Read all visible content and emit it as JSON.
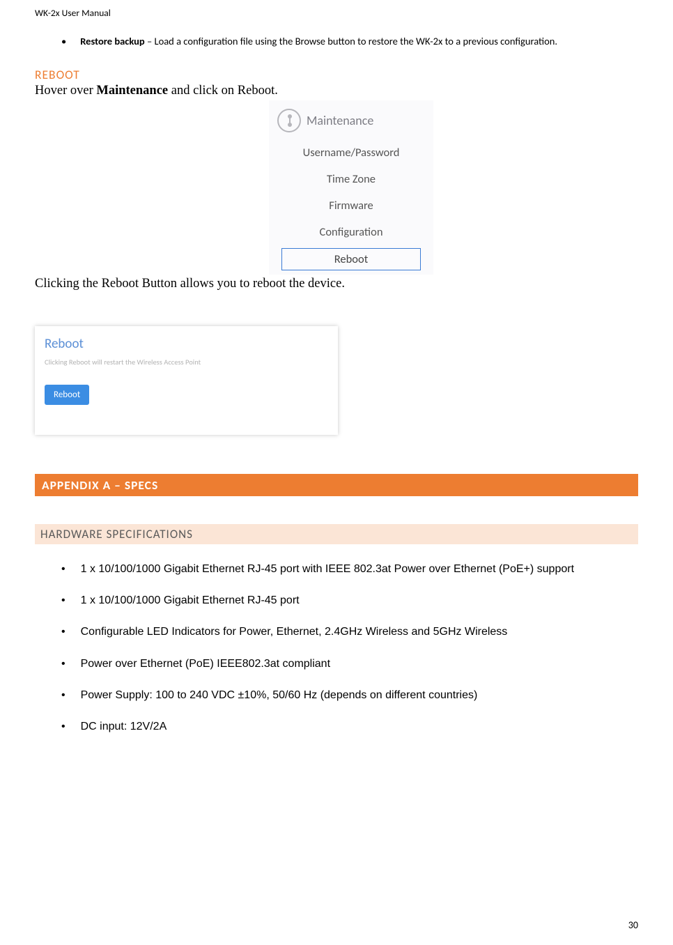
{
  "header": "WK-2x User Manual",
  "intro": {
    "label": "Restore backup",
    "text": " – Load a configuration file using the Browse button to restore the WK-2x to a previous configuration."
  },
  "rebootSection": {
    "title": "REBOOT",
    "line1a": "Hover over ",
    "line1bold": "Maintenance",
    "line1b": " and click on Reboot.",
    "menu": {
      "top": "Maintenance",
      "items": [
        "Username/Password",
        "Time Zone",
        "Firmware",
        "Configuration"
      ],
      "selected": "Reboot"
    },
    "line2": "Clicking the Reboot Button allows you to reboot the device."
  },
  "rebootPanel": {
    "title": "Reboot",
    "sub": "Clicking Reboot will restart the Wireless Access Point",
    "btn": "Reboot"
  },
  "appendix": "APPENDIX A – SPECS",
  "hwTitle": "HARDWARE SPECIFICATIONS",
  "specs": [
    "1 x 10/100/1000 Gigabit Ethernet RJ-45 port with IEEE 802.3at Power over Ethernet (PoE+) support",
    "1 x 10/100/1000 Gigabit Ethernet RJ-45 port",
    "Configurable LED Indicators for Power, Ethernet, 2.4GHz Wireless and 5GHz Wireless",
    "Power over Ethernet (PoE) IEEE802.3at compliant",
    "Power Supply: 100 to 240 VDC ±10%, 50/60 Hz (depends on different countries)",
    "DC input: 12V/2A"
  ],
  "pageNum": "30"
}
